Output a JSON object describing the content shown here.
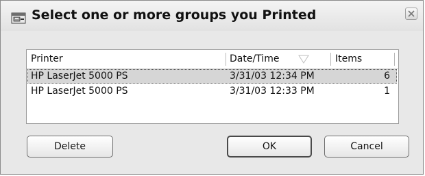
{
  "window": {
    "title": "Select one or more groups you Printed",
    "close_icon": "close-icon",
    "app_icon": "printer-dialog-icon"
  },
  "list": {
    "columns": [
      {
        "label": "Printer"
      },
      {
        "label": "Date/Time",
        "sort_icon": "sort-indicator-icon"
      },
      {
        "label": "Items"
      }
    ],
    "rows": [
      {
        "printer": "HP LaserJet 5000 PS",
        "datetime": "3/31/03 12:34 PM",
        "items": "6",
        "selected": true
      },
      {
        "printer": "HP LaserJet 5000 PS",
        "datetime": "3/31/03 12:33 PM",
        "items": "1",
        "selected": false
      }
    ]
  },
  "buttons": {
    "delete": "Delete",
    "ok": "OK",
    "cancel": "Cancel"
  }
}
